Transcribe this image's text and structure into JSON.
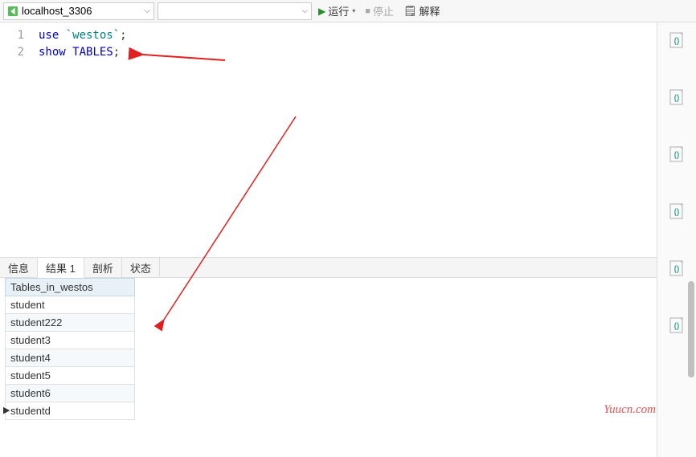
{
  "toolbar": {
    "connection": "localhost_3306",
    "run_label": "运行",
    "stop_label": "停止",
    "explain_label": "解释"
  },
  "editor": {
    "lines": [
      {
        "num": "1",
        "tokens": [
          {
            "t": "use ",
            "c": "kw"
          },
          {
            "t": "`westos`",
            "c": "str"
          },
          {
            "t": ";",
            "c": "punct"
          }
        ]
      },
      {
        "num": "2",
        "tokens": [
          {
            "t": "show ",
            "c": "kw"
          },
          {
            "t": "TABLES",
            "c": "kw"
          },
          {
            "t": ";",
            "c": "punct"
          }
        ]
      }
    ]
  },
  "tabs": {
    "items": [
      {
        "label": "信息",
        "active": false
      },
      {
        "label": "结果 1",
        "active": true
      },
      {
        "label": "剖析",
        "active": false
      },
      {
        "label": "状态",
        "active": false
      }
    ]
  },
  "results": {
    "header": "Tables_in_westos",
    "rows": [
      "student",
      "student222",
      "student3",
      "student4",
      "student5",
      "student6",
      "studentd"
    ],
    "current_row_index": 6
  },
  "watermark": "Yuucn.com"
}
